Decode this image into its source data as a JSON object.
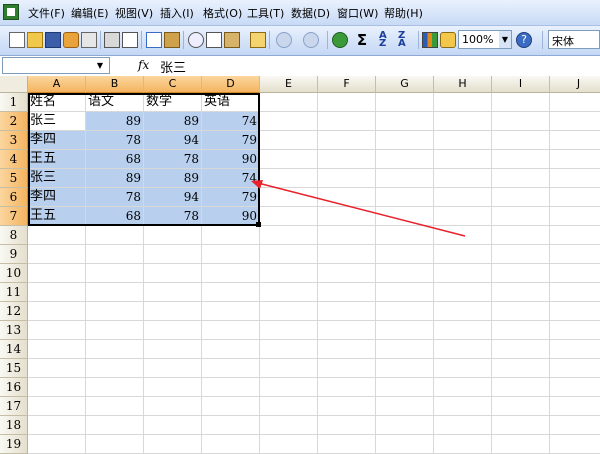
{
  "menu": {
    "items": [
      "文件(F)",
      "编辑(E)",
      "视图(V)",
      "插入(I)",
      "格式(O)",
      "工具(T)",
      "数据(D)",
      "窗口(W)",
      "帮助(H)"
    ]
  },
  "toolbar": {
    "zoom_value": "100%",
    "font_name": "宋体",
    "icons": [
      "new-icon",
      "open-icon",
      "save-icon",
      "permission-icon",
      "print-icon",
      "print-preview-icon",
      "spelling-icon",
      "research-icon",
      "cut-icon",
      "copy-icon",
      "paste-icon",
      "format-painter-icon",
      "undo-icon",
      "redo-icon",
      "hyperlink-icon",
      "autosum-icon",
      "sort-ascending-icon",
      "sort-descending-icon",
      "chart-wizard-icon",
      "drawing-icon",
      "help-icon"
    ]
  },
  "formula_bar": {
    "name_box_value": "",
    "fx_label": "fx",
    "content": "张三"
  },
  "sheet": {
    "columns": [
      "A",
      "B",
      "C",
      "D",
      "E",
      "F",
      "G",
      "H",
      "I",
      "J"
    ],
    "rows": [
      "1",
      "2",
      "3",
      "4",
      "5",
      "6",
      "7",
      "8",
      "9",
      "10",
      "11",
      "12",
      "13",
      "14",
      "15",
      "16",
      "17",
      "18",
      "19"
    ],
    "data": [
      [
        "姓名",
        "语文",
        "数学",
        "英语"
      ],
      [
        "张三",
        "89",
        "89",
        "74"
      ],
      [
        "李四",
        "78",
        "94",
        "79"
      ],
      [
        "王五",
        "68",
        "78",
        "90"
      ],
      [
        "张三",
        "89",
        "89",
        "74"
      ],
      [
        "李四",
        "78",
        "94",
        "79"
      ],
      [
        "王五",
        "68",
        "78",
        "90"
      ]
    ]
  },
  "colors": {
    "selection_fill": "#b8d0ee",
    "header_selected": "#f4b460",
    "annotation_arrow": "#e8212b"
  }
}
